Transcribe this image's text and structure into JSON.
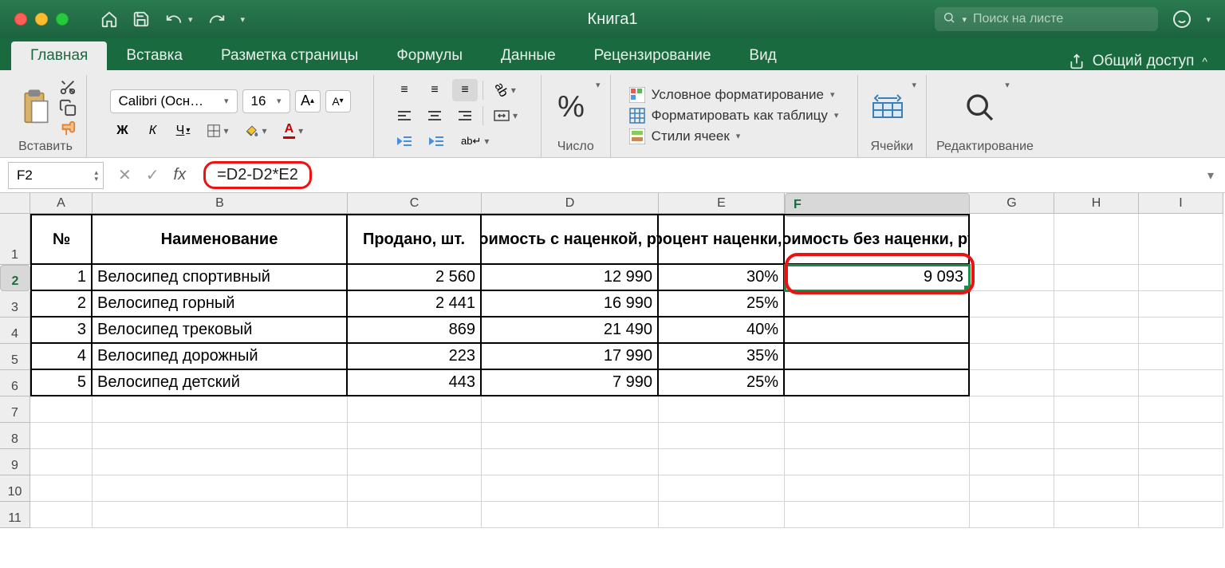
{
  "titlebar": {
    "title": "Книга1"
  },
  "search": {
    "placeholder": "Поиск на листе"
  },
  "tabs": {
    "items": [
      "Главная",
      "Вставка",
      "Разметка страницы",
      "Формулы",
      "Данные",
      "Рецензирование",
      "Вид"
    ],
    "active": 0,
    "share": "Общий доступ"
  },
  "ribbon": {
    "paste": "Вставить",
    "font_name": "Calibri (Осн…",
    "font_size": "16",
    "font_inc": "A",
    "font_dec": "A",
    "bold": "Ж",
    "italic": "К",
    "underline": "Ч",
    "number_label": "Число",
    "cond_format": "Условное форматирование",
    "format_table": "Форматировать как таблицу",
    "cell_styles": "Стили ячеек",
    "cells": "Ячейки",
    "editing": "Редактирование"
  },
  "formula_bar": {
    "cell_ref": "F2",
    "formula": "=D2-D2*E2"
  },
  "columns": [
    "A",
    "B",
    "C",
    "D",
    "E",
    "F",
    "G",
    "H",
    "I"
  ],
  "headers": {
    "num": "№",
    "name": "Наименование",
    "sold": "Продано, шт.",
    "price_markup": "Стоимость с наценкой, руб.",
    "markup_pct": "Процент наценки, %",
    "price_no_markup": "Стоимость без наценки, руб."
  },
  "data": [
    {
      "n": "1",
      "name": "Велосипед спортивный",
      "sold": "2 560",
      "price": "12 990",
      "pct": "30%",
      "nomark": "9 093"
    },
    {
      "n": "2",
      "name": "Велосипед горный",
      "sold": "2 441",
      "price": "16 990",
      "pct": "25%",
      "nomark": ""
    },
    {
      "n": "3",
      "name": "Велосипед трековый",
      "sold": "869",
      "price": "21 490",
      "pct": "40%",
      "nomark": ""
    },
    {
      "n": "4",
      "name": "Велосипед дорожный",
      "sold": "223",
      "price": "17 990",
      "pct": "35%",
      "nomark": ""
    },
    {
      "n": "5",
      "name": "Велосипед детский",
      "sold": "443",
      "price": "7 990",
      "pct": "25%",
      "nomark": ""
    }
  ],
  "row_labels": [
    "1",
    "2",
    "3",
    "4",
    "5",
    "6",
    "7",
    "8",
    "9",
    "10",
    "11"
  ]
}
